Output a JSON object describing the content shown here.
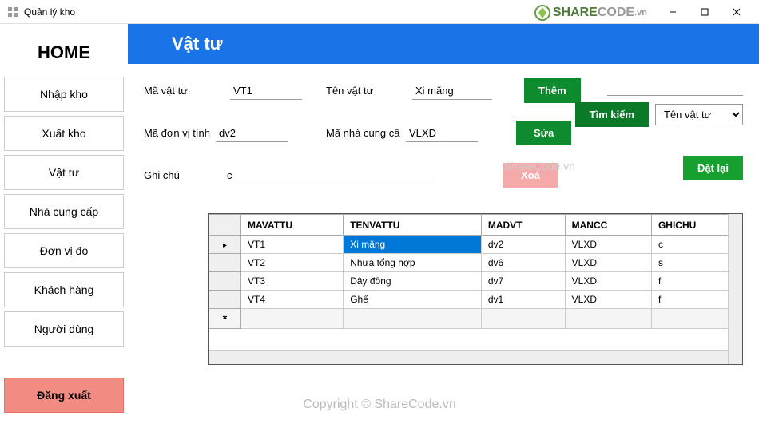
{
  "window": {
    "title": "Quản lý kho"
  },
  "watermark": {
    "logo_share": "SHARE",
    "logo_code": "CODE",
    "logo_vn": ".vn",
    "text_bottom": "Copyright © ShareCode.vn",
    "text_mid": "ShareCode.vn"
  },
  "sidebar": {
    "home": "HOME",
    "items": [
      {
        "label": "Nhập kho"
      },
      {
        "label": "Xuất kho"
      },
      {
        "label": "Vật tư"
      },
      {
        "label": "Nhà cung cấp"
      },
      {
        "label": "Đơn vị đo"
      },
      {
        "label": "Khách hàng"
      },
      {
        "label": "Người dùng"
      }
    ],
    "logout": "Đăng xuất"
  },
  "page": {
    "title": "Vật tư"
  },
  "form": {
    "ma_vat_tu_label": "Mã vật tư",
    "ma_vat_tu_value": "VT1",
    "ten_vat_tu_label": "Tên vật tư",
    "ten_vat_tu_value": "Xi măng",
    "ma_don_vi_label": "Mã đơn vị tính",
    "ma_don_vi_value": "dv2",
    "ma_ncc_label": "Mã nhà cung cấ",
    "ma_ncc_value": "VLXD",
    "ghi_chu_label": "Ghi chú",
    "ghi_chu_value": "c"
  },
  "buttons": {
    "them": "Thêm",
    "sua": "Sửa",
    "xoa": "Xoá",
    "tim_kiem": "Tìm kiếm",
    "dat_lai": "Đặt lại"
  },
  "search": {
    "input_value": "",
    "select_value": "Tên vật tư"
  },
  "grid": {
    "headers": [
      "MAVATTU",
      "TENVATTU",
      "MADVT",
      "MANCC",
      "GHICHU"
    ],
    "rows": [
      {
        "cells": [
          "VT1",
          "Xi măng",
          "dv2",
          "VLXD",
          "c"
        ],
        "selected": true,
        "selected_col": 1
      },
      {
        "cells": [
          "VT2",
          "Nhựa tổng hợp",
          "dv6",
          "VLXD",
          "s"
        ]
      },
      {
        "cells": [
          "VT3",
          "Dây đồng",
          "dv7",
          "VLXD",
          "f"
        ]
      },
      {
        "cells": [
          "VT4",
          "Ghế",
          "dv1",
          "VLXD",
          "f"
        ]
      }
    ]
  }
}
